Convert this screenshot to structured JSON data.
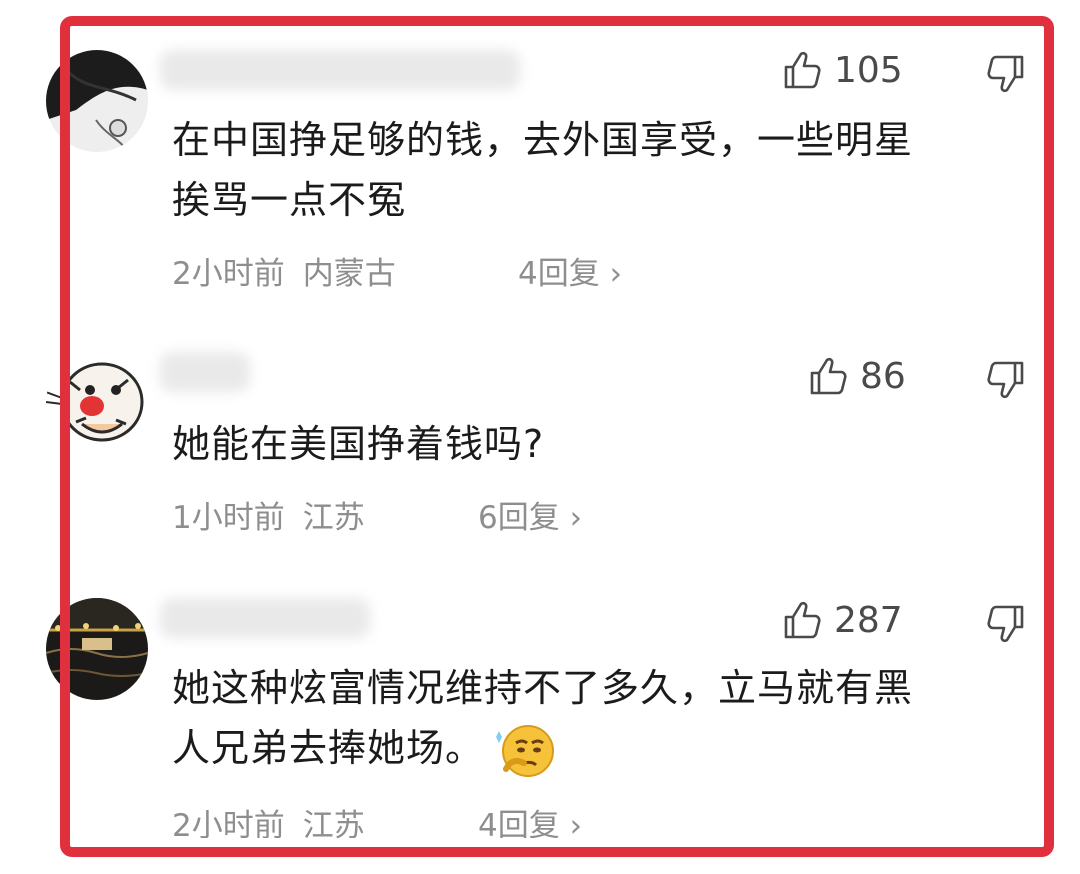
{
  "comments": [
    {
      "likes": "105",
      "text_line1": "在中国挣足够的钱，去外国享受，一些明星",
      "text_line2": "挨骂一点不冤",
      "time": "2小时前",
      "location": "内蒙古",
      "replies": "4回复 ›"
    },
    {
      "likes": "86",
      "text_line1": "她能在美国挣着钱吗?",
      "time": "1小时前",
      "location": "江苏",
      "replies": "6回复 ›"
    },
    {
      "likes": "287",
      "text_line1": "她这种炫富情况维持不了多久，立马就有黑",
      "text_line2": "人兄弟去捧她场。",
      "time": "2小时前",
      "location": "江苏",
      "replies": "4回复 ›"
    }
  ],
  "colors": {
    "frame": "#e0303e",
    "meta": "#8e8e8e",
    "text": "#1b1b1b"
  },
  "icons": [
    "thumbs-up-icon",
    "thumbs-down-icon",
    "thinking-emoji"
  ]
}
